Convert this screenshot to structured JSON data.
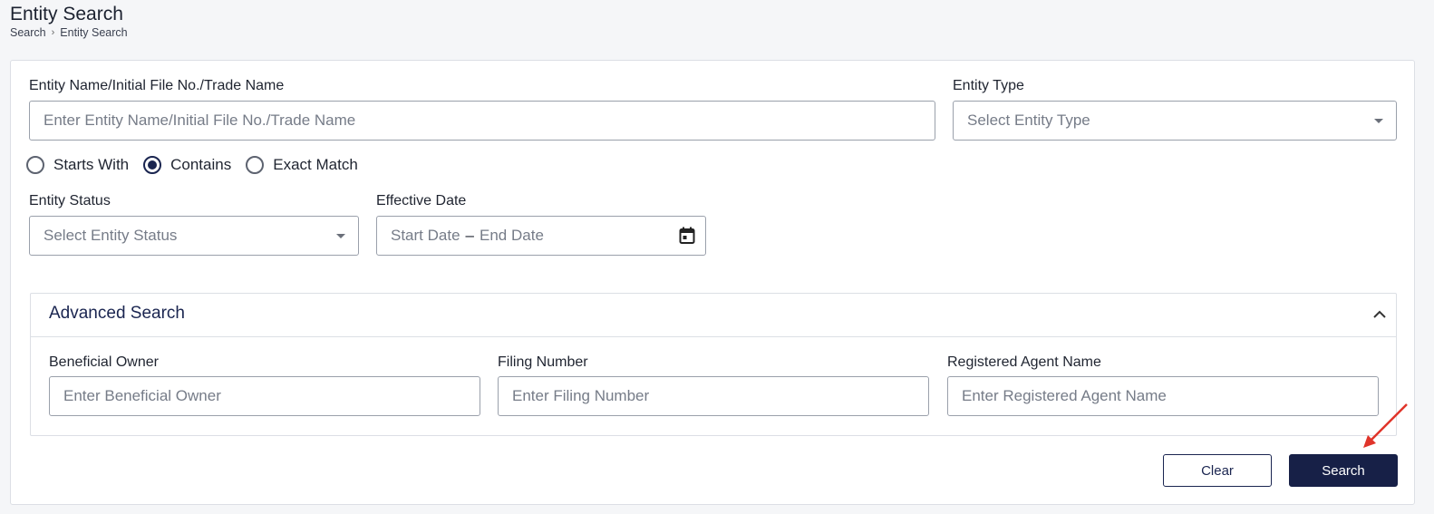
{
  "header": {
    "title": "Entity Search",
    "breadcrumb": [
      "Search",
      "Entity Search"
    ]
  },
  "form": {
    "entity_name": {
      "label": "Entity Name/Initial File No./Trade Name",
      "placeholder": "Enter Entity Name/Initial File No./Trade Name"
    },
    "entity_type": {
      "label": "Entity Type",
      "placeholder": "Select Entity Type"
    },
    "match_mode": {
      "options": [
        "Starts With",
        "Contains",
        "Exact Match"
      ],
      "selected": "Contains"
    },
    "entity_status": {
      "label": "Entity Status",
      "placeholder": "Select Entity Status"
    },
    "effective_date": {
      "label": "Effective Date",
      "start_placeholder": "Start Date",
      "separator": "–",
      "end_placeholder": "End Date"
    },
    "advanced": {
      "title": "Advanced Search",
      "expanded": true,
      "beneficial_owner": {
        "label": "Beneficial Owner",
        "placeholder": "Enter Beneficial Owner"
      },
      "filing_number": {
        "label": "Filing Number",
        "placeholder": "Enter Filing Number"
      },
      "registered_agent": {
        "label": "Registered Agent Name",
        "placeholder": "Enter Registered Agent Name"
      }
    },
    "buttons": {
      "clear": "Clear",
      "search": "Search"
    }
  },
  "colors": {
    "primary": "#172047",
    "annotation_arrow": "#e0342a"
  },
  "icons": {
    "dropdown": "caret-down-icon",
    "calendar": "calendar-icon",
    "collapse": "chevron-up-icon",
    "annotation": "red-arrow-icon"
  }
}
